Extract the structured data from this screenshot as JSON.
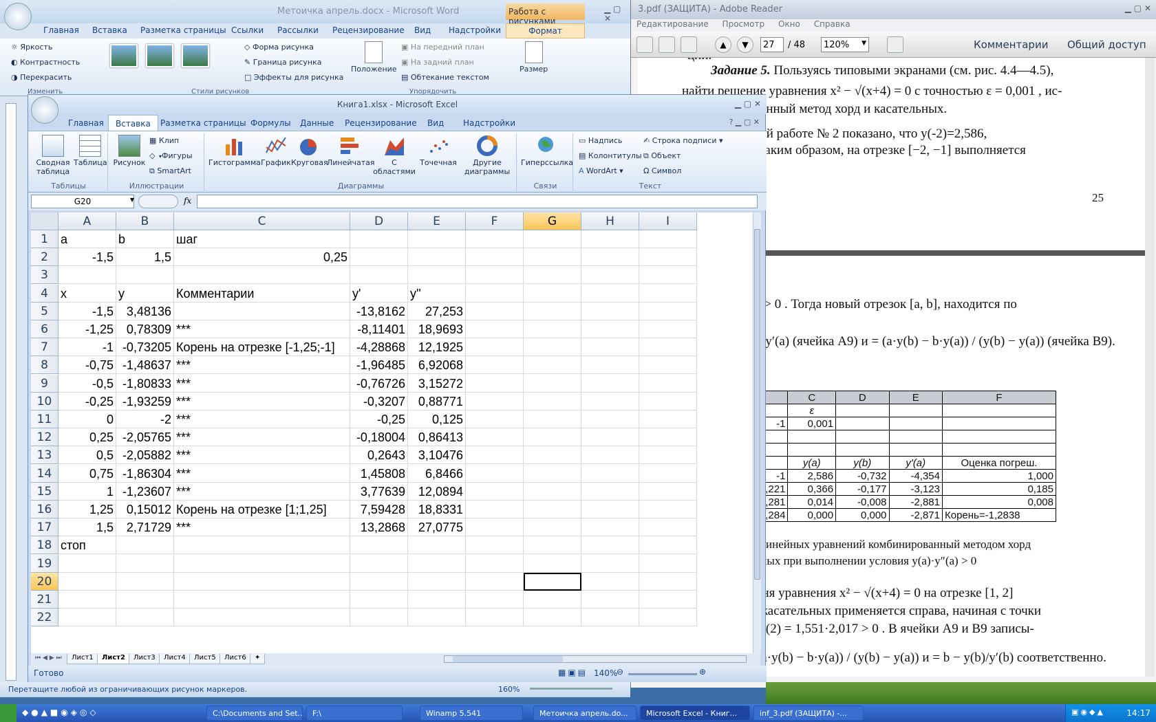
{
  "reader": {
    "title": "3.pdf (ЗАЩИТА) - Adobe Reader",
    "menu": [
      "Редактирование",
      "Просмотр",
      "Окно",
      "Справка"
    ],
    "page_current": "27",
    "page_total": "/ 48",
    "zoom": "120%",
    "comments_label": "Комментарии",
    "share_label": "Общий доступ",
    "text": {
      "p1": "ции.",
      "p2a": "Задание 5.",
      "p2b": " Пользуясь типовыми экранами (см. рис. 4.4—4.5),",
      "p3": "найти решение уравнения  x² − √(x+4) = 0  с точностью  ε = 0,001 , ис-",
      "p4": "ированный метод хорд и касательных.",
      "p5": "торной  работе  № 2  показано,  что  y(-2)=2,586,",
      "p6": "88 . Таким образом, на отрезке [−2, −1] выполняется",
      "pagenum": "25",
      "p7": "y″(a) > 0 . Тогда новый отрезок [a, b], находится по",
      "p8": "y(a) / y′(a)  (ячейка A9) и  = (a·y(b) − b·y(a)) / (y(b) − y(a))  (ячейка B9).",
      "p9": "ие нелинейных уравнений комбинированный методом хорд",
      "p10": "ательных при выполнении условия  y(a)·y″(a) > 0",
      "p11": "е  корня  уравнения   x² − √(x+4) = 0   на  отрезке  [1, 2]",
      "p12": "етод касательных применяется справа, начиная с точки",
      "p13": "(2)·y″(2) = 1,551·2,017 > 0 . В ячейки A9 и B9 записы-",
      "p14": "ы  = (a·y(b) − b·y(a)) / (y(b) − y(a))  и  = b − y(b)/y′(b)  соответственно."
    },
    "table": {
      "header": [
        "B",
        "C",
        "D",
        "E",
        "F"
      ],
      "rows": [
        [
          "b",
          "ε",
          "",
          "",
          ""
        ],
        [
          "-1",
          "0,001",
          "",
          "",
          ""
        ],
        [
          "",
          "",
          "",
          "",
          ""
        ],
        [
          "",
          "",
          "",
          "",
          ""
        ],
        [
          "b",
          "y(a)",
          "y(b)",
          "y'(a)",
          "Оценка погреш."
        ],
        [
          "-1",
          "2,586",
          "-0,732",
          "-4,354",
          "1,000"
        ],
        [
          "-1,221",
          "0,366",
          "-0,177",
          "-3,123",
          "0,185"
        ],
        [
          "-1,281",
          "0,014",
          "-0,008",
          "-2,881",
          "0,008"
        ],
        [
          "-1,284",
          "0,000",
          "0,000",
          "-2,871",
          "Корень=-1,2838"
        ]
      ]
    }
  },
  "word": {
    "title": "Метоичка апрель.docx - Microsoft Word",
    "context_tab": "Работа с рисунками",
    "tabs": [
      "Главная",
      "Вставка",
      "Разметка страницы",
      "Ссылки",
      "Рассылки",
      "Рецензирование",
      "Вид",
      "Надстройки",
      "Формат"
    ],
    "adjust": [
      "Яркость",
      "Контрастность",
      "Перекрасить"
    ],
    "adjust_label": "Изменить",
    "styles": [
      "Форма рисунка",
      "Граница рисунка",
      "Эффекты для рисунка"
    ],
    "styles_label": "Стили рисунков",
    "arrange": [
      "На передний план",
      "На задний план",
      "Обтекание текстом"
    ],
    "position_label": "Положение",
    "arrange_label": "Упорядочить",
    "size_label": "Размер",
    "status": "Перетащите любой из ограничивающих рисунок маркеров.",
    "zoom": "160%"
  },
  "excel": {
    "title": "Книга1.xlsx - Microsoft Excel",
    "tabs": [
      "Главная",
      "Вставка",
      "Разметка страницы",
      "Формулы",
      "Данные",
      "Рецензирование",
      "Вид",
      "Надстройки"
    ],
    "active_tab": "Вставка",
    "groups": {
      "tables": {
        "label": "Таблицы",
        "pivot": "Сводная таблица",
        "table": "Таблица"
      },
      "illustrations": {
        "label": "Иллюстрации",
        "picture": "Рисунок",
        "clip": "Клип",
        "shapes": "Фигуры",
        "smartart": "SmartArt"
      },
      "charts": {
        "label": "Диаграммы",
        "items": [
          "Гистограмма",
          "График",
          "Круговая",
          "Линейчатая",
          "С областями",
          "Точечная",
          "Другие диаграммы"
        ]
      },
      "links": {
        "label": "Связи",
        "hyperlink": "Гиперссылка"
      },
      "text": {
        "label": "Текст",
        "items": [
          "Надпись",
          "Колонтитулы",
          "WordArt",
          "Строка подписи",
          "Объект",
          "Символ"
        ]
      }
    },
    "name_box": "G20",
    "fx": "fx",
    "columns": [
      "A",
      "B",
      "C",
      "D",
      "E",
      "F",
      "G",
      "H",
      "I"
    ],
    "selected_column": "G",
    "selected_row": "20",
    "rows": [
      {
        "n": "1",
        "c": [
          "a",
          "b",
          "шаг",
          "",
          ""
        ]
      },
      {
        "n": "2",
        "c": [
          "-1,5",
          "1,5",
          "0,25",
          "",
          ""
        ]
      },
      {
        "n": "3",
        "c": [
          "",
          "",
          "",
          "",
          ""
        ]
      },
      {
        "n": "4",
        "c": [
          "x",
          "y",
          "Комментарии",
          "y'",
          "y''"
        ]
      },
      {
        "n": "5",
        "c": [
          "-1,5",
          "3,48136",
          "",
          "-13,8162",
          "27,253"
        ]
      },
      {
        "n": "6",
        "c": [
          "-1,25",
          "0,78309",
          "***",
          "-8,11401",
          "18,9693"
        ]
      },
      {
        "n": "7",
        "c": [
          "-1",
          "-0,73205",
          "Корень на отрезке [-1,25;-1]",
          "-4,28868",
          "12,1925"
        ]
      },
      {
        "n": "8",
        "c": [
          "-0,75",
          "-1,48637",
          "***",
          "-1,96485",
          "6,92068"
        ]
      },
      {
        "n": "9",
        "c": [
          "-0,5",
          "-1,80833",
          "***",
          "-0,76726",
          "3,15272"
        ]
      },
      {
        "n": "10",
        "c": [
          "-0,25",
          "-1,93259",
          "***",
          "-0,3207",
          "0,88771"
        ]
      },
      {
        "n": "11",
        "c": [
          "0",
          "-2",
          "***",
          "-0,25",
          "0,125"
        ]
      },
      {
        "n": "12",
        "c": [
          "0,25",
          "-2,05765",
          "***",
          "-0,18004",
          "0,86413"
        ]
      },
      {
        "n": "13",
        "c": [
          "0,5",
          "-2,05882",
          "***",
          "0,2643",
          "3,10476"
        ]
      },
      {
        "n": "14",
        "c": [
          "0,75",
          "-1,86304",
          "***",
          "1,45808",
          "6,8466"
        ]
      },
      {
        "n": "15",
        "c": [
          "1",
          "-1,23607",
          "***",
          "3,77639",
          "12,0894"
        ]
      },
      {
        "n": "16",
        "c": [
          "1,25",
          "0,15012",
          "Корень на отрезке [1;1,25]",
          "7,59428",
          "18,8331"
        ]
      },
      {
        "n": "17",
        "c": [
          "1,5",
          "2,71729",
          "***",
          "13,2868",
          "27,0775"
        ]
      },
      {
        "n": "18",
        "c": [
          "стоп",
          "",
          "",
          "",
          ""
        ]
      },
      {
        "n": "19",
        "c": [
          "",
          "",
          "",
          "",
          ""
        ]
      },
      {
        "n": "20",
        "c": [
          "",
          "",
          "",
          "",
          ""
        ]
      },
      {
        "n": "21",
        "c": [
          "",
          "",
          "",
          "",
          ""
        ]
      },
      {
        "n": "22",
        "c": [
          "",
          "",
          "",
          "",
          ""
        ]
      }
    ],
    "sheets": [
      "Лист1",
      "Лист2",
      "Лист3",
      "Лист4",
      "Лист5",
      "Лист6"
    ],
    "active_sheet": "Лист2",
    "status": "Готово",
    "zoom": "140%"
  },
  "taskbar": {
    "items": [
      "C:\\Documents and Set...",
      "F:\\",
      "Winamp 5.541",
      "Метоичка апрель.do...",
      "Microsoft Excel - Книг...",
      "inf_3.pdf (ЗАЩИТА) -..."
    ],
    "active": "Microsoft Excel - Книг...",
    "clock": "14:17"
  },
  "colors": {
    "excel_accent": "#15428b",
    "selection": "#f9c65a",
    "taskbar": "#2453b3"
  }
}
